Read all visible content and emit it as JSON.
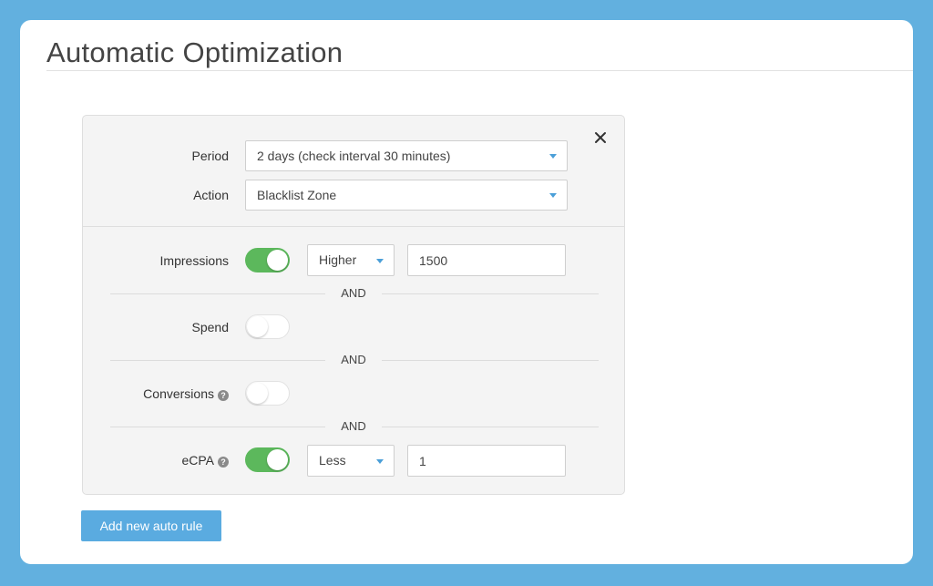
{
  "page": {
    "title": "Automatic Optimization"
  },
  "rule": {
    "close_icon": "close-icon",
    "period": {
      "label": "Period",
      "value": "2 days (check interval 30 minutes)"
    },
    "action": {
      "label": "Action",
      "value": "Blacklist Zone"
    },
    "conditions": [
      {
        "label": "Impressions",
        "enabled": true,
        "operator": "Higher",
        "value": "1500",
        "help": false
      },
      {
        "label": "Spend",
        "enabled": false,
        "help": false
      },
      {
        "label": "Conversions",
        "enabled": false,
        "help": true
      },
      {
        "label": "eCPA",
        "enabled": true,
        "operator": "Less",
        "value": "1",
        "help": true
      }
    ],
    "separator_text": "AND",
    "help_glyph": "?"
  },
  "actions": {
    "add_rule_label": "Add new auto rule"
  },
  "colors": {
    "background": "#62b0df",
    "toggle_on": "#5cb85c",
    "button": "#5aabe0",
    "caret": "#4b9fd8"
  }
}
